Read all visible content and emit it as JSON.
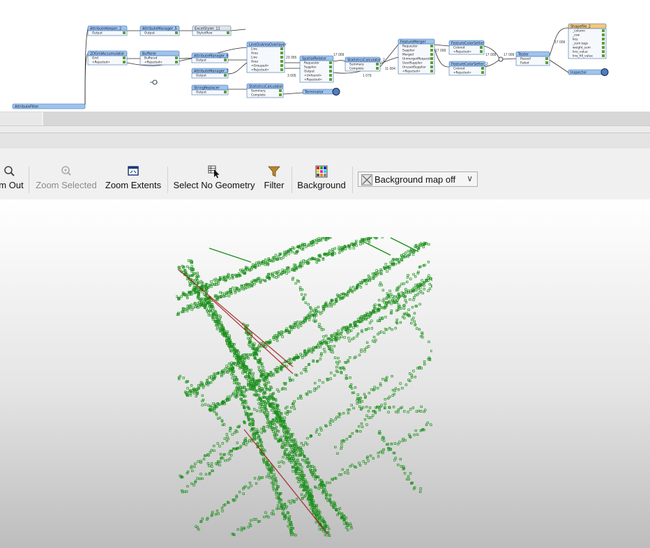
{
  "workspace": {
    "nodes": [
      {
        "id": "ak2",
        "title": "AttributeKeeper_2",
        "ports": [
          "Output"
        ]
      },
      {
        "id": "am5",
        "title": "AttributeManager_5",
        "ports": [
          "Output"
        ]
      },
      {
        "id": "es11",
        "title": "ExcelStyler_11",
        "ports": [
          "StyledRow"
        ]
      },
      {
        "id": "ga",
        "title": "2DGridAccumulator",
        "ports": [
          "Grid",
          "<Rejected>"
        ]
      },
      {
        "id": "buf",
        "title": "Bufferer",
        "ports": [
          "Buffered",
          "<Rejected>"
        ]
      },
      {
        "id": "am6",
        "title": "AttributeManager_6",
        "ports": [
          "Output"
        ]
      },
      {
        "id": "am7",
        "title": "AttributeManager_7",
        "ports": [
          "Output"
        ]
      },
      {
        "id": "sr",
        "title": "StringReplacer",
        "ports": [
          "Output"
        ]
      },
      {
        "id": "loa",
        "title": "LineOnAreaOverlayer",
        "ports": [
          "Line",
          "Area",
          "Line",
          "Area",
          "<Grouped>",
          "<Rejected>"
        ]
      },
      {
        "id": "sc",
        "title": "StatisticsCalculator",
        "ports": [
          "Summary",
          "Complete"
        ]
      },
      {
        "id": "term",
        "title": "Terminator",
        "ports": []
      },
      {
        "id": "spr",
        "title": "SpatialRelator",
        "ports": [
          "Requestor",
          "Supplier",
          "Output",
          "<Unfound>",
          "<Rejected>"
        ]
      },
      {
        "id": "sc2",
        "title": "StatisticsCalculator_2",
        "ports": [
          "Summary",
          "Complete"
        ]
      },
      {
        "id": "fm",
        "title": "FeatureMerger",
        "ports": [
          "Requestor",
          "Supplier",
          "Merged",
          "UnmergedRequestor",
          "UsedSupplier",
          "UnusedSupplier",
          "<Rejected>"
        ]
      },
      {
        "id": "fcs",
        "title": "FeatureColorSetter",
        "ports": [
          "Colored",
          "<Rejected>"
        ]
      },
      {
        "id": "fcs2",
        "title": "FeatureColorSetter_2",
        "ports": [
          "Colored",
          "<Rejected>"
        ]
      },
      {
        "id": "tst",
        "title": "Tester",
        "ports": [
          "Passed",
          "Failed"
        ]
      },
      {
        "id": "shp",
        "title": "Shapefile_2",
        "ports": [
          "_column",
          "_row",
          "key",
          "_sum.tags",
          "weight_sum",
          "line_value",
          "line_fill_value"
        ]
      },
      {
        "id": "insp",
        "title": "Inspector",
        "ports": []
      },
      {
        "id": "af",
        "title": "AttributeFilter",
        "ports": []
      }
    ],
    "counts": [
      "17 009",
      "17 009",
      "17 009",
      "1 079",
      "17 009",
      "17 009",
      "23 055",
      "3 005",
      "11 004"
    ]
  },
  "toolbar": {
    "zoom_out_label": "m Out",
    "zoom_selected_label": "Zoom Selected",
    "zoom_extents_label": "Zoom Extents",
    "select_no_geometry_label": "Select No Geometry",
    "filter_label": "Filter",
    "background_label": "Background",
    "background_map_value": "Background map off"
  },
  "icons": {
    "zoom_out": "magnifier-icon",
    "zoom_selected": "magnifier-disabled-icon",
    "zoom_extents": "window-extents-icon",
    "select_no_geometry": "cursor-table-icon",
    "filter": "funnel-icon",
    "background": "color-grid-icon",
    "background_map": "map-off-icon",
    "dropdown": "chevron-down-icon"
  },
  "colors": {
    "node_header": "#9fc3ee",
    "node_border": "#3e6ea8",
    "geometry_primary": "#1a8f1a",
    "geometry_secondary": "#a01818"
  }
}
